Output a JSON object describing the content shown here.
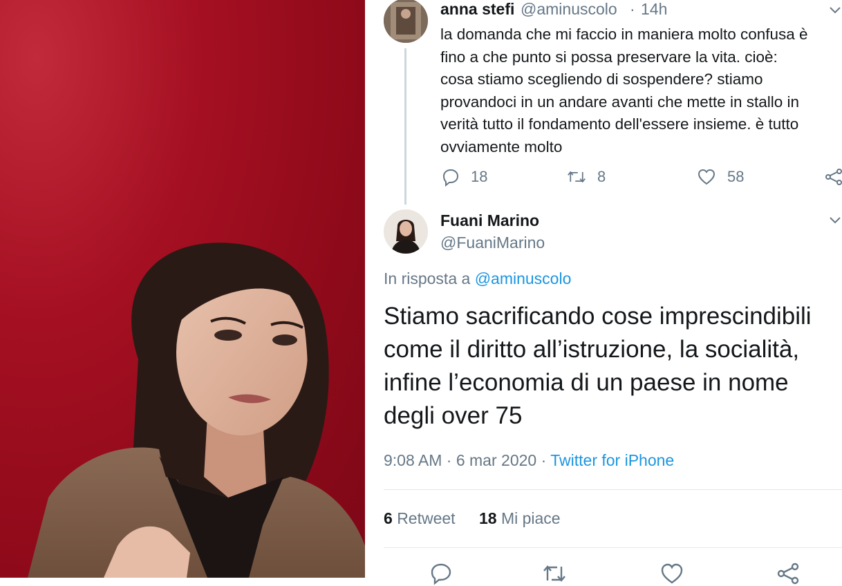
{
  "colors": {
    "background_red": "#a51022",
    "link_blue": "#1b95e0",
    "muted_gray": "#657786",
    "text_dark": "#14171a"
  },
  "photo": {
    "subject": "woman with dark hair in brown teddy coat against red wall"
  },
  "tweet1": {
    "name": "anna stefi",
    "handle": "@aminuscolo",
    "separator": "·",
    "time": "14h",
    "text": "la domanda che mi faccio in maniera molto confusa è\nfino a che punto si possa preservare la vita. cioè:\ncosa stiamo scegliendo di sospendere? stiamo\nprovandoci in un andare avanti che mette in stallo in\nverità tutto il fondamento dell'essere insieme. è tutto\novviamente molto",
    "replies": "18",
    "retweets": "8",
    "likes": "58",
    "icons": [
      "reply-icon",
      "retweet-icon",
      "like-icon",
      "share-icon",
      "chevron-down-icon"
    ]
  },
  "tweet2": {
    "name": "Fuani Marino",
    "handle": "@FuaniMarino",
    "reply_prefix": "In risposta a",
    "reply_handle": "@aminuscolo",
    "text": "Stiamo sacrificando cose imprescindibili\ncome il diritto all’istruzione, la socialità,\ninfine l’economia di un paese in nome\ndegli over 75",
    "time": "9:08 AM",
    "date_sep": "·",
    "date": "6 mar 2020",
    "source_sep": "·",
    "source": "Twitter for iPhone",
    "retweet_count": "6",
    "retweet_label": "Retweet",
    "like_count": "18",
    "like_label": "Mi piace"
  }
}
